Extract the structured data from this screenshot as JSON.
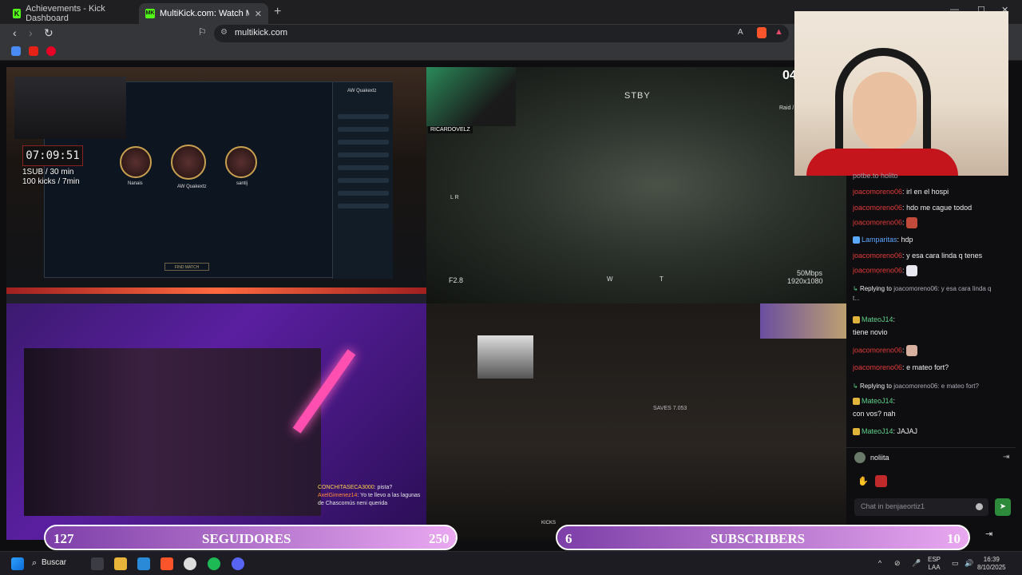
{
  "browser": {
    "tabs": [
      {
        "label": "Achievements - Kick Dashboard",
        "favicon": "K",
        "favicon_color": "#53fc18"
      },
      {
        "label": "MultiKick.com: Watch Multiple S",
        "favicon": "MK",
        "favicon_color": "#53fc18"
      }
    ],
    "url": "multikick.com"
  },
  "tiles": {
    "tile1": {
      "timer": "07:09:51",
      "note1": "1SUB / 30 min",
      "note2": "100 kicks / 7min",
      "lol": {
        "player1": "Nanais",
        "player2": "AW Quakextz",
        "player3": "santij",
        "find_match": "FIND MATCH",
        "profile": "AW Quakextz"
      }
    },
    "tile2": {
      "cam_handle": "RICARDOVELZ",
      "stby": "STBY",
      "fstop": "F2.8",
      "bitrate": "50Mbps",
      "resolution": "1920x1080",
      "raid": "Raid /",
      "lr": "L R",
      "compass_w": "W",
      "compass_t": "T",
      "counter": "04"
    },
    "tile3": {
      "chat1_user": "CONCHITASECA3000",
      "chat1_text": ": pista?",
      "chat2_user": "AxelGimenez14",
      "chat2_text": ": Yo te llevo a las lagunas de Chascomús neni querida"
    },
    "tile4": {
      "monitor_text": "SAVES 7.053",
      "kicks_label": "KICKS"
    }
  },
  "chat": {
    "partial": "potbe.to holito",
    "messages": [
      {
        "user": "joacomoreno06",
        "text": "irl en el hospi",
        "color": "red"
      },
      {
        "user": "joacomoreno06",
        "text": "hdo me cague todod",
        "color": "red"
      },
      {
        "user": "joacomoreno06",
        "text": "",
        "color": "red",
        "emote": "#c14a3a"
      },
      {
        "user": "Lamparitas",
        "text": "hdp",
        "color": "blue"
      },
      {
        "user": "joacomoreno06",
        "text": "y esa cara linda q tenes",
        "color": "red"
      },
      {
        "user": "joacomoreno06",
        "text": "",
        "color": "red",
        "emote": "#e8e8f0"
      }
    ],
    "reply1": {
      "label": "Replying to",
      "target": "joacomoreno06",
      "quote": ": y esa cara linda q",
      "quote2": "t...",
      "user": "MateoJ14",
      "text": "tiene novio"
    },
    "messages2": [
      {
        "user": "joacomoreno06",
        "text": "",
        "color": "red",
        "emote": "#d8b0a0"
      },
      {
        "user": "joacomoreno06",
        "text": "e mateo fort?",
        "color": "red"
      }
    ],
    "reply2": {
      "label": "Replying to",
      "target": "joacomoreno06",
      "quote": ": e mateo fort?",
      "user": "MateoJ14",
      "text": "con vos? nah"
    },
    "last": {
      "user": "MateoJ14",
      "text": "JAJAJ"
    },
    "current_user": "noliita",
    "input_placeholder": "Chat in benjaeortiz1"
  },
  "goals": {
    "left": {
      "current": "127",
      "label": "SEGUIDORES",
      "target": "250"
    },
    "right": {
      "current": "6",
      "label": "SUBSCRIBERS",
      "target": "10"
    }
  },
  "taskbar": {
    "search": "Buscar",
    "lang1": "ESP",
    "lang2": "LAA",
    "time": "16:39",
    "date": "8/10/2025"
  }
}
